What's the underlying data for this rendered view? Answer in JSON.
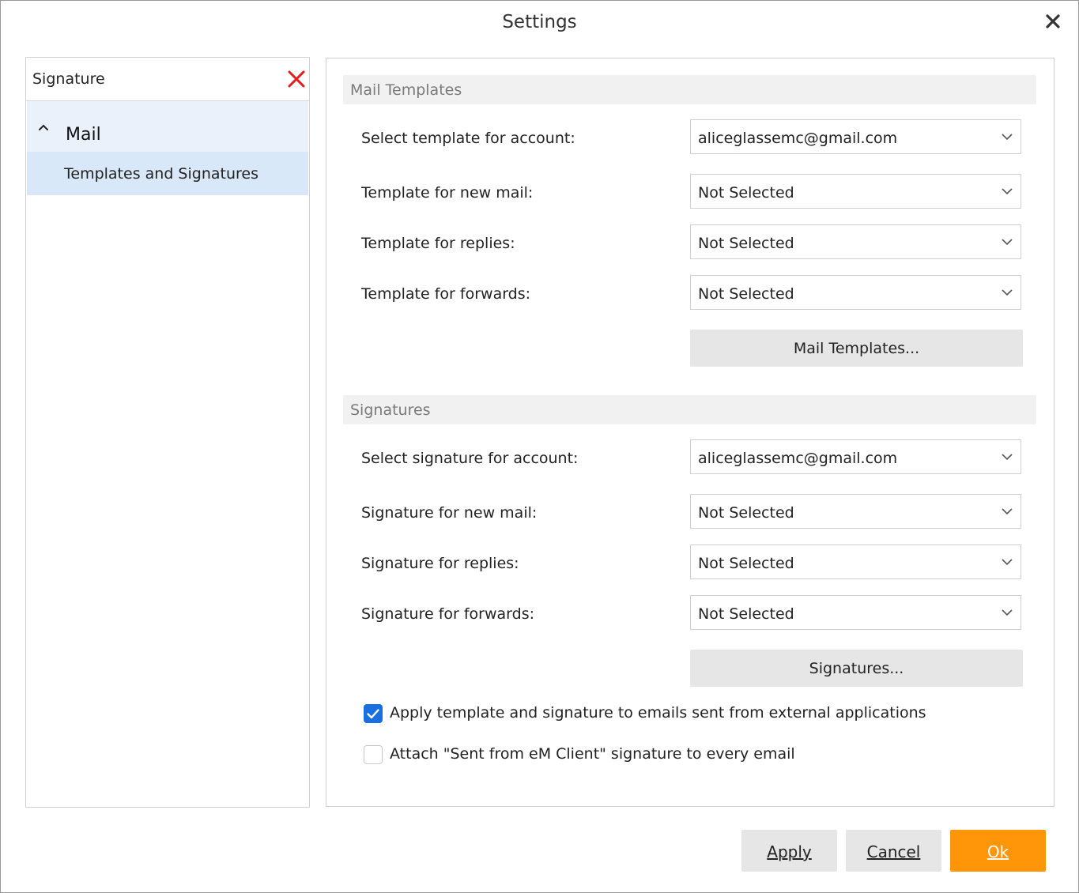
{
  "window": {
    "title": "Settings"
  },
  "search": {
    "value": "Signature"
  },
  "tree": {
    "group_label": "Mail",
    "selected_item_label": "Templates and Signatures"
  },
  "mail_templates": {
    "header": "Mail Templates",
    "rows": [
      {
        "label": "Select template for account:",
        "value": "aliceglassemc@gmail.com"
      },
      {
        "label": "Template for new mail:",
        "value": "Not Selected"
      },
      {
        "label": "Template for replies:",
        "value": "Not Selected"
      },
      {
        "label": "Template for forwards:",
        "value": "Not Selected"
      }
    ],
    "button_label": "Mail Templates..."
  },
  "signatures": {
    "header": "Signatures",
    "rows": [
      {
        "label": "Select signature for account:",
        "value": "aliceglassemc@gmail.com"
      },
      {
        "label": "Signature for new mail:",
        "value": "Not Selected"
      },
      {
        "label": "Signature for replies:",
        "value": "Not Selected"
      },
      {
        "label": "Signature for forwards:",
        "value": "Not Selected"
      }
    ],
    "button_label": "Signatures..."
  },
  "options": {
    "apply_external": {
      "label": "Apply template and signature to emails sent from external applications",
      "checked": true
    },
    "attach_sent_from": {
      "label": "Attach \"Sent from eM Client\" signature to every email",
      "checked": false
    }
  },
  "footer": {
    "apply_label": "Apply",
    "cancel_label": "Cancel",
    "ok_label": "Ok"
  },
  "colors": {
    "accent": "#ff9509",
    "checkbox": "#1a6fe0",
    "clear_icon": "#e02020",
    "selection": "#d9e8f8"
  },
  "icons": [
    "close-icon",
    "clear-search-icon",
    "chevron-up-icon",
    "chevron-down-icon",
    "checkmark-icon"
  ]
}
